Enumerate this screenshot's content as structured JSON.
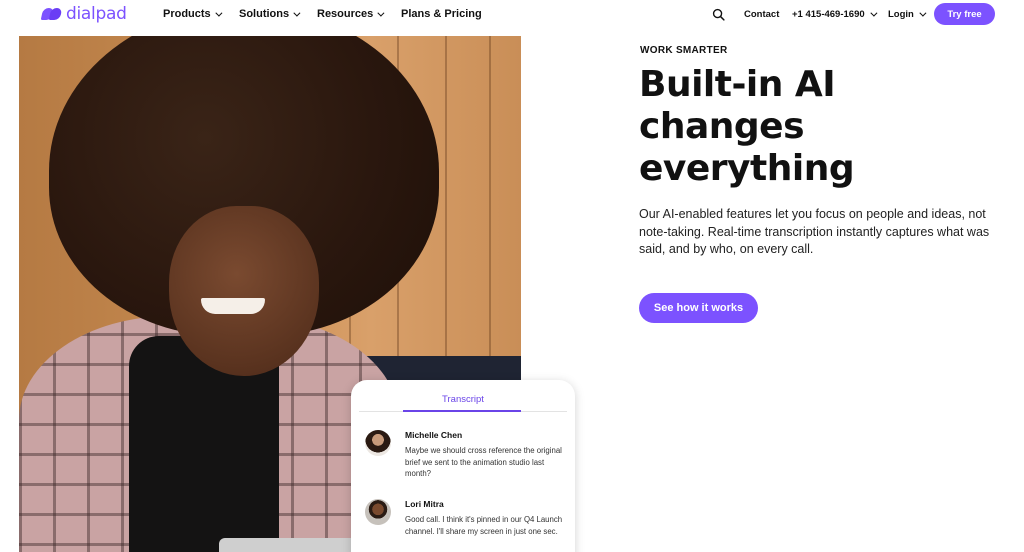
{
  "brand": {
    "name": "dialpad",
    "color": "#7c52ff"
  },
  "nav": {
    "items": [
      {
        "label": "Products",
        "has_dropdown": true
      },
      {
        "label": "Solutions",
        "has_dropdown": true
      },
      {
        "label": "Resources",
        "has_dropdown": true
      },
      {
        "label": "Plans & Pricing",
        "has_dropdown": false
      }
    ],
    "search_icon": "search-icon",
    "contact": "Contact",
    "phone": "+1 415-469-1690",
    "login": "Login",
    "cta": "Try free"
  },
  "hero": {
    "eyebrow": "WORK SMARTER",
    "headline_lines": [
      "Built-in AI",
      "changes",
      "everything"
    ],
    "body": "Our AI-enabled features let you focus on people and ideas, not note-taking. Real-time transcription instantly captures what was said, and by who, on every call.",
    "cta": "See how it works"
  },
  "transcript": {
    "tab": "Transcript",
    "messages": [
      {
        "name": "Michelle Chen",
        "text": "Maybe we should cross reference the original brief we sent to the animation studio last month?"
      },
      {
        "name": "Lori Mitra",
        "text": "Good call. I think it's pinned in our Q4 Launch channel. I'll share my screen in just one sec."
      }
    ]
  }
}
